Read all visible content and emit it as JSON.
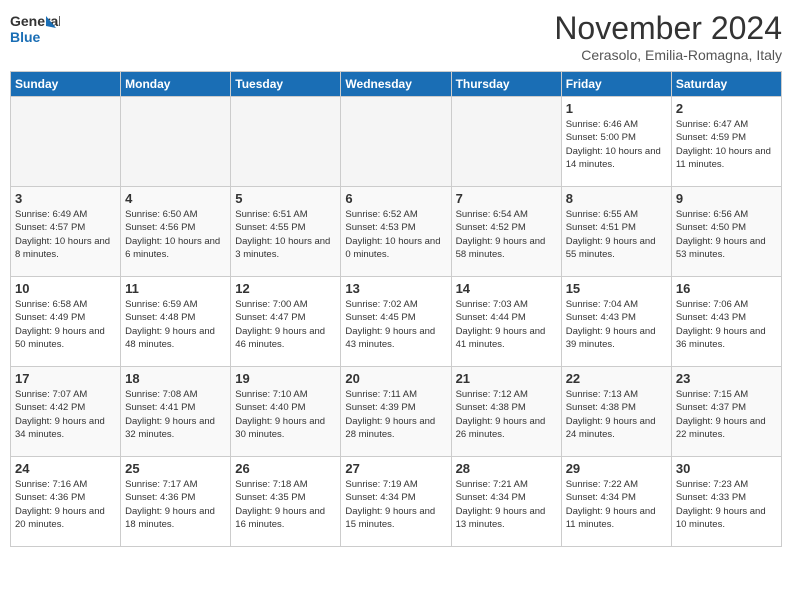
{
  "logo": {
    "line1": "General",
    "line2": "Blue"
  },
  "header": {
    "month": "November 2024",
    "location": "Cerasolo, Emilia-Romagna, Italy"
  },
  "days_of_week": [
    "Sunday",
    "Monday",
    "Tuesday",
    "Wednesday",
    "Thursday",
    "Friday",
    "Saturday"
  ],
  "weeks": [
    [
      {
        "day": "",
        "info": ""
      },
      {
        "day": "",
        "info": ""
      },
      {
        "day": "",
        "info": ""
      },
      {
        "day": "",
        "info": ""
      },
      {
        "day": "",
        "info": ""
      },
      {
        "day": "1",
        "info": "Sunrise: 6:46 AM\nSunset: 5:00 PM\nDaylight: 10 hours and 14 minutes."
      },
      {
        "day": "2",
        "info": "Sunrise: 6:47 AM\nSunset: 4:59 PM\nDaylight: 10 hours and 11 minutes."
      }
    ],
    [
      {
        "day": "3",
        "info": "Sunrise: 6:49 AM\nSunset: 4:57 PM\nDaylight: 10 hours and 8 minutes."
      },
      {
        "day": "4",
        "info": "Sunrise: 6:50 AM\nSunset: 4:56 PM\nDaylight: 10 hours and 6 minutes."
      },
      {
        "day": "5",
        "info": "Sunrise: 6:51 AM\nSunset: 4:55 PM\nDaylight: 10 hours and 3 minutes."
      },
      {
        "day": "6",
        "info": "Sunrise: 6:52 AM\nSunset: 4:53 PM\nDaylight: 10 hours and 0 minutes."
      },
      {
        "day": "7",
        "info": "Sunrise: 6:54 AM\nSunset: 4:52 PM\nDaylight: 9 hours and 58 minutes."
      },
      {
        "day": "8",
        "info": "Sunrise: 6:55 AM\nSunset: 4:51 PM\nDaylight: 9 hours and 55 minutes."
      },
      {
        "day": "9",
        "info": "Sunrise: 6:56 AM\nSunset: 4:50 PM\nDaylight: 9 hours and 53 minutes."
      }
    ],
    [
      {
        "day": "10",
        "info": "Sunrise: 6:58 AM\nSunset: 4:49 PM\nDaylight: 9 hours and 50 minutes."
      },
      {
        "day": "11",
        "info": "Sunrise: 6:59 AM\nSunset: 4:48 PM\nDaylight: 9 hours and 48 minutes."
      },
      {
        "day": "12",
        "info": "Sunrise: 7:00 AM\nSunset: 4:47 PM\nDaylight: 9 hours and 46 minutes."
      },
      {
        "day": "13",
        "info": "Sunrise: 7:02 AM\nSunset: 4:45 PM\nDaylight: 9 hours and 43 minutes."
      },
      {
        "day": "14",
        "info": "Sunrise: 7:03 AM\nSunset: 4:44 PM\nDaylight: 9 hours and 41 minutes."
      },
      {
        "day": "15",
        "info": "Sunrise: 7:04 AM\nSunset: 4:43 PM\nDaylight: 9 hours and 39 minutes."
      },
      {
        "day": "16",
        "info": "Sunrise: 7:06 AM\nSunset: 4:43 PM\nDaylight: 9 hours and 36 minutes."
      }
    ],
    [
      {
        "day": "17",
        "info": "Sunrise: 7:07 AM\nSunset: 4:42 PM\nDaylight: 9 hours and 34 minutes."
      },
      {
        "day": "18",
        "info": "Sunrise: 7:08 AM\nSunset: 4:41 PM\nDaylight: 9 hours and 32 minutes."
      },
      {
        "day": "19",
        "info": "Sunrise: 7:10 AM\nSunset: 4:40 PM\nDaylight: 9 hours and 30 minutes."
      },
      {
        "day": "20",
        "info": "Sunrise: 7:11 AM\nSunset: 4:39 PM\nDaylight: 9 hours and 28 minutes."
      },
      {
        "day": "21",
        "info": "Sunrise: 7:12 AM\nSunset: 4:38 PM\nDaylight: 9 hours and 26 minutes."
      },
      {
        "day": "22",
        "info": "Sunrise: 7:13 AM\nSunset: 4:38 PM\nDaylight: 9 hours and 24 minutes."
      },
      {
        "day": "23",
        "info": "Sunrise: 7:15 AM\nSunset: 4:37 PM\nDaylight: 9 hours and 22 minutes."
      }
    ],
    [
      {
        "day": "24",
        "info": "Sunrise: 7:16 AM\nSunset: 4:36 PM\nDaylight: 9 hours and 20 minutes."
      },
      {
        "day": "25",
        "info": "Sunrise: 7:17 AM\nSunset: 4:36 PM\nDaylight: 9 hours and 18 minutes."
      },
      {
        "day": "26",
        "info": "Sunrise: 7:18 AM\nSunset: 4:35 PM\nDaylight: 9 hours and 16 minutes."
      },
      {
        "day": "27",
        "info": "Sunrise: 7:19 AM\nSunset: 4:34 PM\nDaylight: 9 hours and 15 minutes."
      },
      {
        "day": "28",
        "info": "Sunrise: 7:21 AM\nSunset: 4:34 PM\nDaylight: 9 hours and 13 minutes."
      },
      {
        "day": "29",
        "info": "Sunrise: 7:22 AM\nSunset: 4:34 PM\nDaylight: 9 hours and 11 minutes."
      },
      {
        "day": "30",
        "info": "Sunrise: 7:23 AM\nSunset: 4:33 PM\nDaylight: 9 hours and 10 minutes."
      }
    ]
  ]
}
